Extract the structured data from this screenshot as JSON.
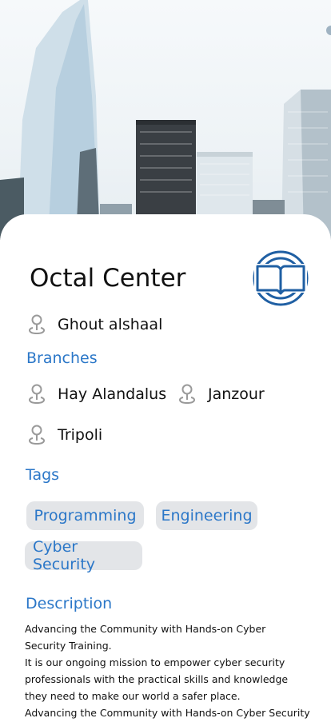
{
  "center": {
    "name": "Octal Center",
    "location": "Ghout alshaal"
  },
  "branches": {
    "heading": "Branches",
    "items": [
      "Hay Alandalus",
      "Janzour",
      "Tripoli"
    ]
  },
  "tags": {
    "heading": "Tags",
    "items": [
      "Programming",
      "Engineering",
      "Cyber Security"
    ]
  },
  "description": {
    "heading": "Description",
    "text": "Advancing the Community with Hands-on Cyber\nSecurity Training.\nIt is our ongoing mission to empower cyber security\n professionals with the practical skills and knowledge\n they need to make our world a safer place.\nAdvancing the Community with Hands-on Cyber Security"
  },
  "colors": {
    "accent": "#2b77c8",
    "tag_bg": "#e3e5e8",
    "logo": "#1f5fa3"
  },
  "icons": {
    "location": "location-pin-icon",
    "logo": "open-book-logo-icon"
  }
}
